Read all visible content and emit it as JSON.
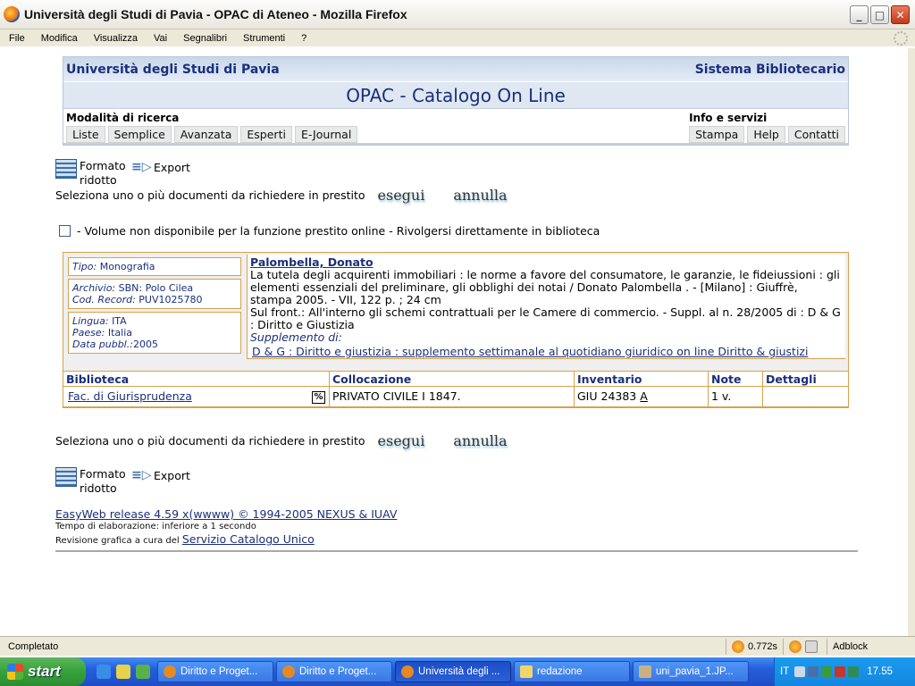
{
  "window": {
    "title": "Università degli Studi di Pavia - OPAC di Ateneo - Mozilla Firefox",
    "buttons": {
      "minimize": "_",
      "maximize": "□",
      "close": "✕"
    }
  },
  "menubar": [
    "File",
    "Modifica",
    "Visualizza",
    "Vai",
    "Segnalibri",
    "Strumenti",
    "?"
  ],
  "header": {
    "university": "Università degli Studi di Pavia",
    "system": "Sistema Bibliotecario",
    "title": "OPAC - Catalogo On Line",
    "search_label": "Modalità di ricerca",
    "search_modes": [
      "Liste",
      "Semplice",
      "Avanzata",
      "Esperti",
      "E-Journal"
    ],
    "info_label": "Info e servizi",
    "info_items": [
      "Stampa",
      "Help",
      "Contatti"
    ]
  },
  "toolbar": {
    "format_label": "Formato ridotto",
    "export_label": "Export"
  },
  "selection": {
    "text": "Seleziona uno o più documenti da richiedere in prestito",
    "execute": "esegui",
    "cancel": "annulla"
  },
  "legend": "- Volume non disponibile per la funzione prestito online - Rivolgersi direttamente in biblioteca",
  "record": {
    "tipo_label": "Tipo:",
    "tipo": "Monografia",
    "archivio_label": "Archivio:",
    "archivio": "SBN: Polo Cilea",
    "cod_label": "Cod. Record:",
    "cod": "PUV1025780",
    "lingua_label": "Lingua:",
    "lingua": "ITA",
    "paese_label": "Paese:",
    "paese": "Italia",
    "data_label": "Data pubbl.:",
    "data": "2005",
    "author": "Palombella, Donato",
    "description": "La tutela degli acquirenti immobiliari : le norme a favore del consumatore, le garanzie, le fideiussioni : gli elementi essenziali del preliminare, gli obblighi dei notai / Donato Palombella . - [Milano] : Giuffrè, stampa 2005. - VII, 122 p. ; 24 cm",
    "notes": "Sul front.: All'interno gli schemi contrattuali per le Camere di commercio. - Suppl. al n. 28/2005 di : D & G : Diritto e Giustizia",
    "supplement_label": "Supplemento di:",
    "supplement_link": "D & G : Diritto e giustizia : supplemento settimanale al quotidiano giuridico on line Diritto & giustizi"
  },
  "holdings": {
    "headers": [
      "Biblioteca",
      "Collocazione",
      "Inventario",
      "Note",
      "Dettagli"
    ],
    "rows": [
      {
        "biblioteca": "Fac. di Giurisprudenza",
        "collocazione": "PRIVATO CIVILE I 1847.",
        "inventario": "GIU 24383",
        "inventario_link": "A",
        "note": "1 v.",
        "dettagli": ""
      }
    ]
  },
  "footer": {
    "release": "EasyWeb release 4.59 x(wwww) © 1994-2005 NEXUS & IUAV",
    "elapsed": "Tempo di elaborazione: inferiore a 1 secondo",
    "revision_prefix": "Revisione grafica a cura del",
    "revision_link": "Servizio Catalogo Unico"
  },
  "statusbar": {
    "status": "Completato",
    "timer": "0.772s",
    "adblock": "Adblock"
  },
  "taskbar": {
    "start": "start",
    "tasks": [
      "Diritto e Proget...",
      "Diritto e Proget...",
      "Università degli ...",
      "redazione",
      "uni_pavia_1.JP..."
    ],
    "lang": "IT",
    "clock": "17.55"
  }
}
